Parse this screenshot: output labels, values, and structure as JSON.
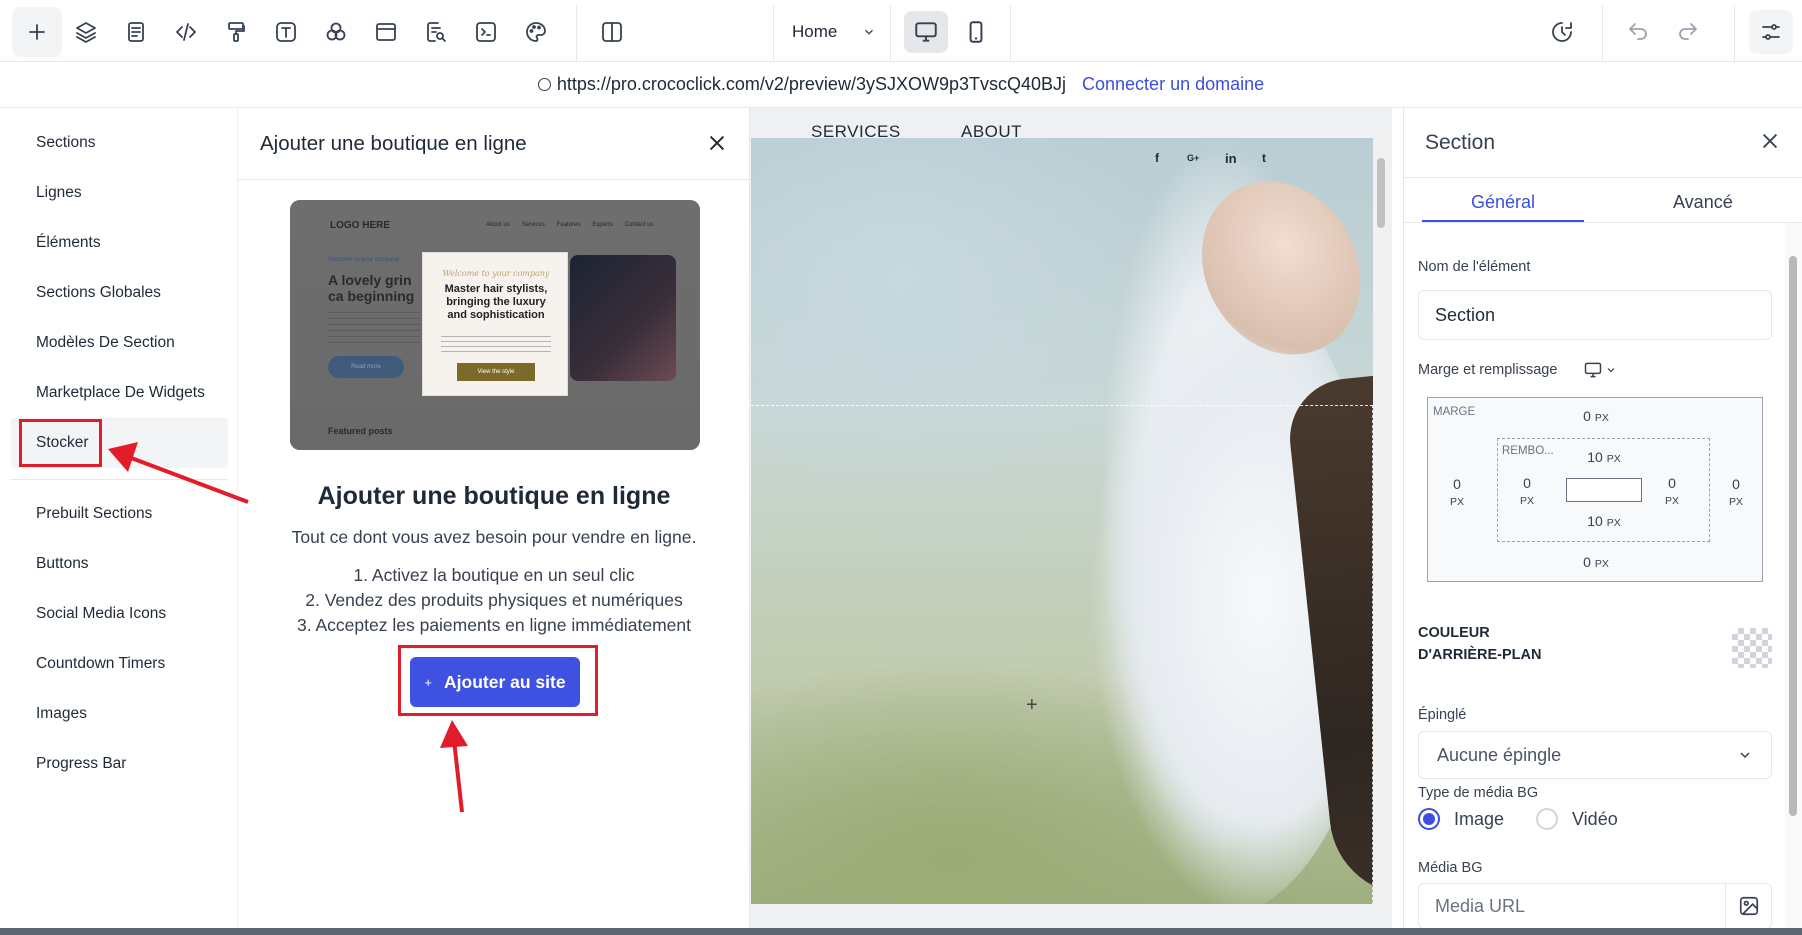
{
  "topbar": {
    "icons": [
      "add-icon",
      "layers-icon",
      "page-icon",
      "code-icon",
      "paint-roller-icon",
      "text-icon",
      "shapes-icon",
      "browser-icon",
      "search-doc-icon",
      "terminal-icon",
      "palette-icon",
      "split-view-icon"
    ],
    "page_select": "Home",
    "right_icons": [
      "history-icon",
      "undo-icon",
      "redo-icon",
      "settings-sliders-icon"
    ]
  },
  "urlbar": {
    "url": "https://pro.crococlick.com/v2/preview/3ySJXOW9p3TvscQ40BJj",
    "connect_domain": "Connecter un domaine"
  },
  "leftnav": {
    "items": [
      {
        "label": "Sections"
      },
      {
        "label": "Lignes"
      },
      {
        "label": "Éléments"
      },
      {
        "label": "Sections Globales"
      },
      {
        "label": "Modèles De Section"
      },
      {
        "label": "Marketplace De Widgets"
      },
      {
        "label": "Stocker"
      },
      {
        "label": "Prebuilt Sections"
      },
      {
        "label": "Buttons"
      },
      {
        "label": "Social Media Icons"
      },
      {
        "label": "Countdown Timers"
      },
      {
        "label": "Images"
      },
      {
        "label": "Progress Bar"
      }
    ],
    "active": "Stocker"
  },
  "panel": {
    "title": "Ajouter une boutique en ligne",
    "preview": {
      "logo": "LOGO HERE",
      "nav": [
        "About us",
        "Services",
        "Features",
        "Experts",
        "Contact us"
      ],
      "kicker": "Welcome to your company",
      "headline": "A lovely grin ca beginning",
      "popup_kicker": "Welcome to your company",
      "popup_headline": "Master hair stylists, bringing the luxury and sophistication",
      "popup_button": "View the style",
      "read_more": "Read more",
      "featured": "Featured posts"
    },
    "heading": "Ajouter une boutique en ligne",
    "subtitle": "Tout ce dont vous avez besoin pour vendre en ligne.",
    "steps": [
      "1. Activez la boutique en un seul clic",
      "2. Vendez des produits physiques et numériques",
      "3. Acceptez les paiements en ligne immédiatement"
    ],
    "button": "Ajouter au site"
  },
  "canvas": {
    "nav": [
      "SERVICES",
      "ABOUT"
    ],
    "social": [
      "f",
      "G+",
      "in",
      "t"
    ]
  },
  "rightpanel": {
    "title": "Section",
    "tabs": [
      "Général",
      "Avancé"
    ],
    "active_tab": "Général",
    "name_label": "Nom de l'élément",
    "name_value": "Section",
    "spacing_label": "Marge et remplissage",
    "box": {
      "margin_label": "MARGE",
      "padding_label": "REMBO...",
      "margin_top": "0",
      "margin_bottom": "0",
      "margin_left": "0",
      "margin_right": "0",
      "padding_top": "10",
      "padding_bottom": "10",
      "padding_left": "0",
      "padding_right": "0",
      "unit": "PX"
    },
    "bg_color_label_1": "COULEUR",
    "bg_color_label_2": "D'ARRIÈRE-PLAN",
    "pinned_label": "Épinglé",
    "pinned_value": "Aucune épingle",
    "media_type_label": "Type de média BG",
    "media_types": [
      "Image",
      "Vidéo"
    ],
    "media_type_selected": "Image",
    "media_label": "Média BG",
    "media_placeholder": "Media URL"
  },
  "colors": {
    "accent": "#3b4fe0",
    "annotation_red": "#e11d2a"
  }
}
